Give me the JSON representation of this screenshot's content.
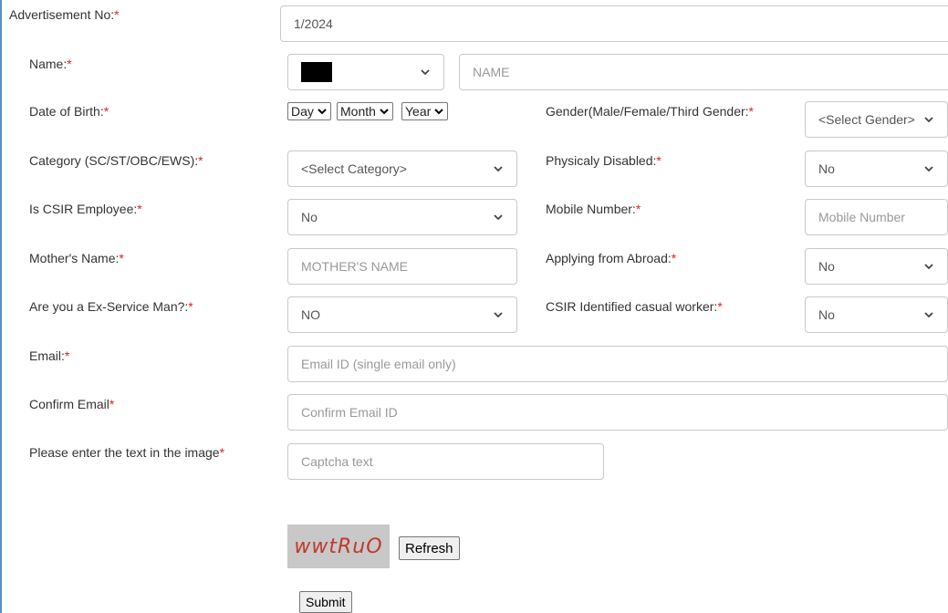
{
  "advertisement": {
    "label": "Advertisement No:",
    "value": "1/2024"
  },
  "name": {
    "label": "Name:",
    "placeholder": "NAME"
  },
  "dob": {
    "label": "Date of Birth:",
    "day": "Day",
    "month": "Month",
    "year": "Year"
  },
  "gender": {
    "label": "Gender(Male/Female/Third Gender:",
    "value": "<Select Gender>"
  },
  "category": {
    "label": "Category (SC/ST/OBC/EWS):",
    "value": "<Select Category>"
  },
  "disabled": {
    "label": "Physicaly Disabled:",
    "value": "No"
  },
  "csir_employee": {
    "label": "Is CSIR Employee:",
    "value": "No"
  },
  "mobile": {
    "label": "Mobile Number:",
    "placeholder": "Mobile Number"
  },
  "mother": {
    "label": "Mother's Name:",
    "placeholder": "MOTHER'S NAME"
  },
  "abroad": {
    "label": "Applying from Abroad:",
    "value": "No"
  },
  "ex_service": {
    "label": "Are you a Ex-Service Man?:",
    "value": "NO"
  },
  "casual_worker": {
    "label": "CSIR Identified casual worker:",
    "value": "No"
  },
  "email": {
    "label": "Email:",
    "placeholder": "Email ID (single email only)"
  },
  "confirm_email": {
    "label": "Confirm Email",
    "placeholder": "Confirm Email ID"
  },
  "captcha": {
    "label": "Please enter the text in the image",
    "placeholder": "Captcha text",
    "image_text": "wwtRuO",
    "refresh_label": "Refresh"
  },
  "submit_label": "Submit",
  "required_marker": "*",
  "colors": {
    "required": "#e02020",
    "border": "#c9c9c9",
    "captcha_text": "#c0392b",
    "captcha_bg": "#c8c8c8"
  }
}
